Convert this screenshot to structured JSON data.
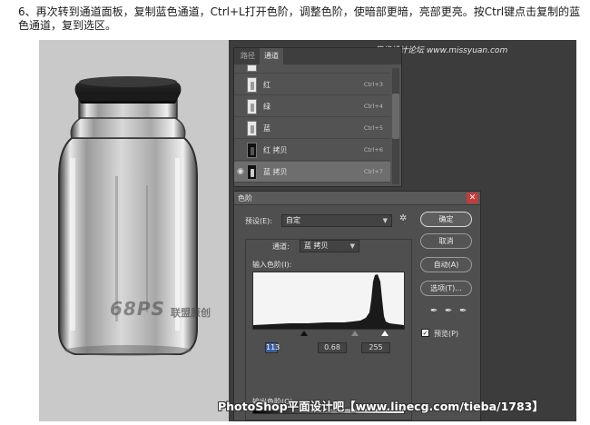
{
  "instruction": "6、再次转到通道面板，复制蓝色通道，Ctrl+L打开色阶，调整色阶，使暗部更暗，亮部更亮。按Ctrl键点击复制的蓝色通道，复到选区。",
  "photo": {
    "watermark_logo": "68PS",
    "watermark_text": "联盟原创"
  },
  "site_watermark": "思缘设计论坛 www.missyuan.com",
  "channels_panel": {
    "tabs": [
      "路径",
      "通道"
    ],
    "rows": [
      {
        "name": "红",
        "shortcut": "Ctrl+3"
      },
      {
        "name": "绿",
        "shortcut": "Ctrl+4"
      },
      {
        "name": "蓝",
        "shortcut": "Ctrl+5"
      },
      {
        "name": "红 拷贝",
        "shortcut": "Ctrl+6"
      },
      {
        "name": "蓝 拷贝",
        "shortcut": "Ctrl+7"
      }
    ]
  },
  "levels_dialog": {
    "title": "色阶",
    "preset_label": "预设(E):",
    "preset_value": "自定",
    "channel_label": "通道:",
    "channel_value": "蓝 拷贝",
    "input_label": "输入色阶(I):",
    "input_values": [
      "113",
      "0.68",
      "255"
    ],
    "output_label": "输出色阶(O):",
    "output_values": [
      "0",
      "255"
    ],
    "buttons": {
      "ok": "确定",
      "cancel": "取消",
      "auto": "自动(A)",
      "options": "选项(T)..."
    },
    "preview_label": "预览(P)",
    "preview_checked": true
  },
  "footer_watermark": "PhotoShop平面设计吧【www.linecg.com/tieba/1783】"
}
